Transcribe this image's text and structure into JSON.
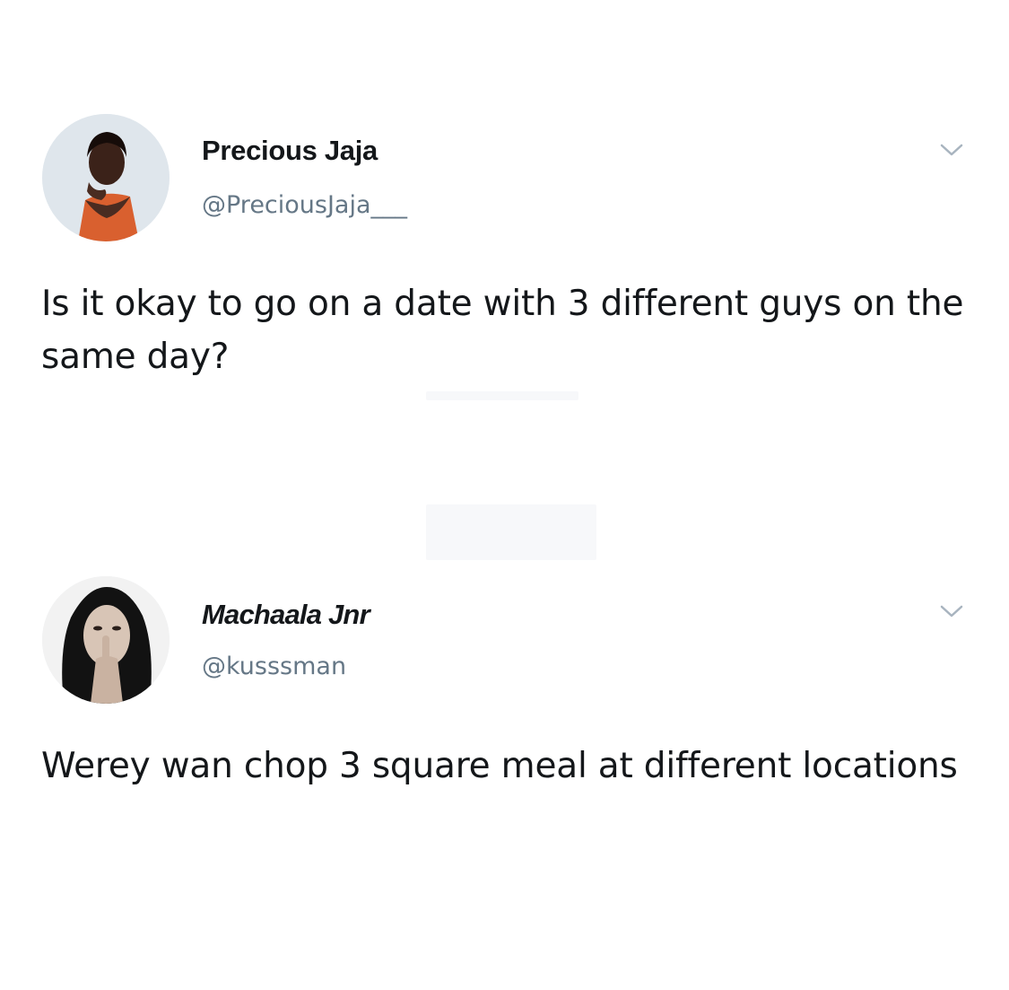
{
  "tweets": [
    {
      "display_name": "Precious Jaja",
      "handle": "@PreciousJaja___",
      "text": "Is it okay to go on a date with 3 different guys on the same day?",
      "avatar_icon": "avatar-photo-woman-orange-top",
      "menu_icon": "chevron-down-icon"
    },
    {
      "display_name": "Machaala Jnr",
      "handle": "@kusssman",
      "text": "Werey wan chop 3 square meal at different locations",
      "avatar_icon": "avatar-photo-woman-shush-gesture",
      "menu_icon": "chevron-down-icon"
    }
  ],
  "colors": {
    "text_primary": "#14171a",
    "text_secondary": "#657786",
    "chevron": "#a8b4bf",
    "background": "#ffffff"
  }
}
